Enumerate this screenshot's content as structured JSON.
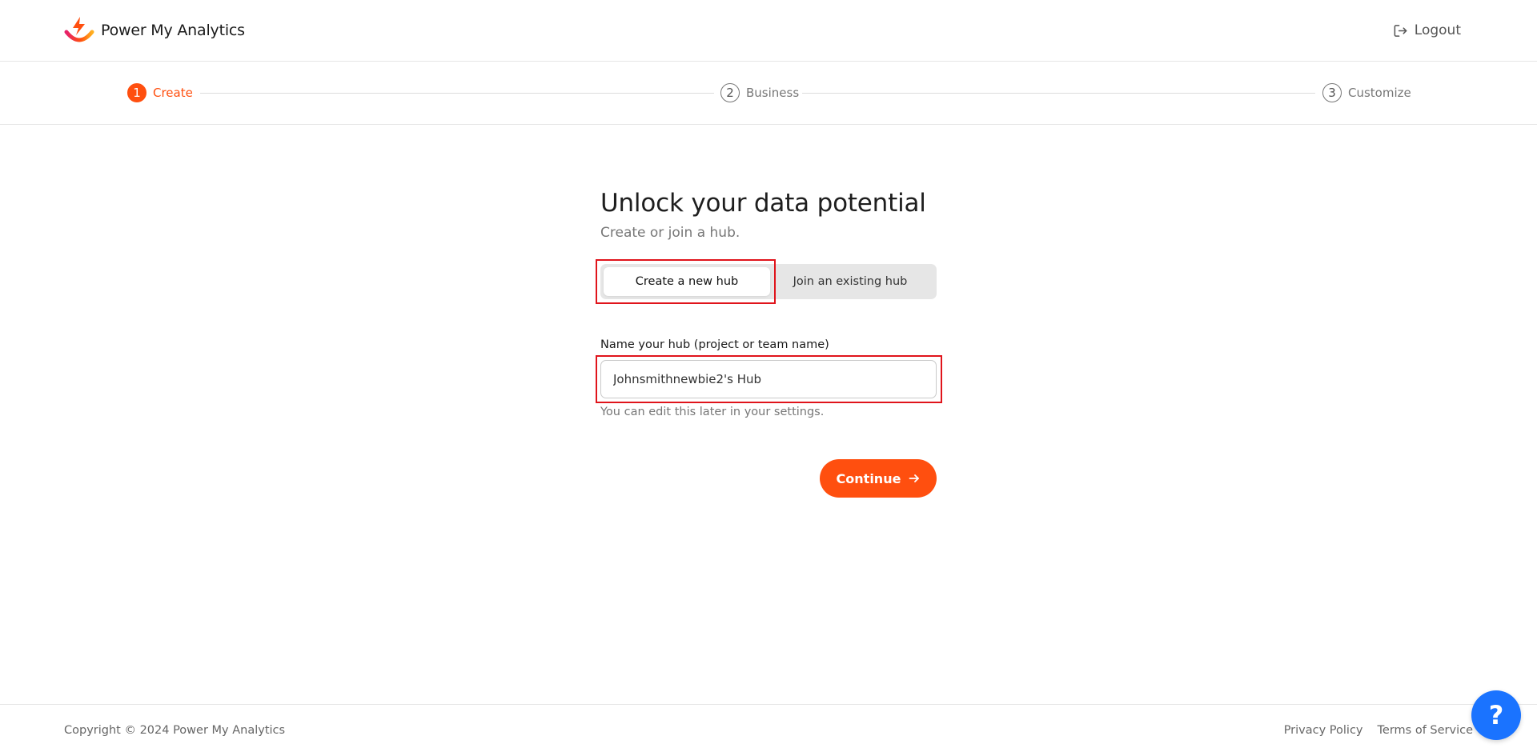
{
  "brand": {
    "name": "Power My Analytics",
    "logo_icon": "bolt-smile-logo-icon",
    "colors": {
      "accent": "#ff4f0f",
      "highlight": "#e0141b",
      "help": "#1a73ff"
    }
  },
  "header": {
    "logout_label": "Logout",
    "logout_icon": "logout-icon"
  },
  "stepper": {
    "steps": [
      {
        "number": "1",
        "label": "Create",
        "active": true
      },
      {
        "number": "2",
        "label": "Business",
        "active": false
      },
      {
        "number": "3",
        "label": "Customize",
        "active": false
      }
    ]
  },
  "main": {
    "title": "Unlock your data potential",
    "subtitle": "Create or join a hub.",
    "toggle": {
      "create_label": "Create a new hub",
      "join_label": "Join an existing hub",
      "selected": "Create a new hub"
    },
    "hub_field": {
      "label": "Name your hub (project or team name)",
      "value": "Johnsmithnewbie2's Hub",
      "hint": "You can edit this later in your settings."
    },
    "continue_label": "Continue",
    "continue_icon": "arrow-right-icon"
  },
  "footer": {
    "copyright": "Copyright © 2024 Power My Analytics",
    "privacy_label": "Privacy Policy",
    "terms_label": "Terms of Service"
  },
  "help": {
    "label": "?",
    "icon": "help-icon"
  }
}
